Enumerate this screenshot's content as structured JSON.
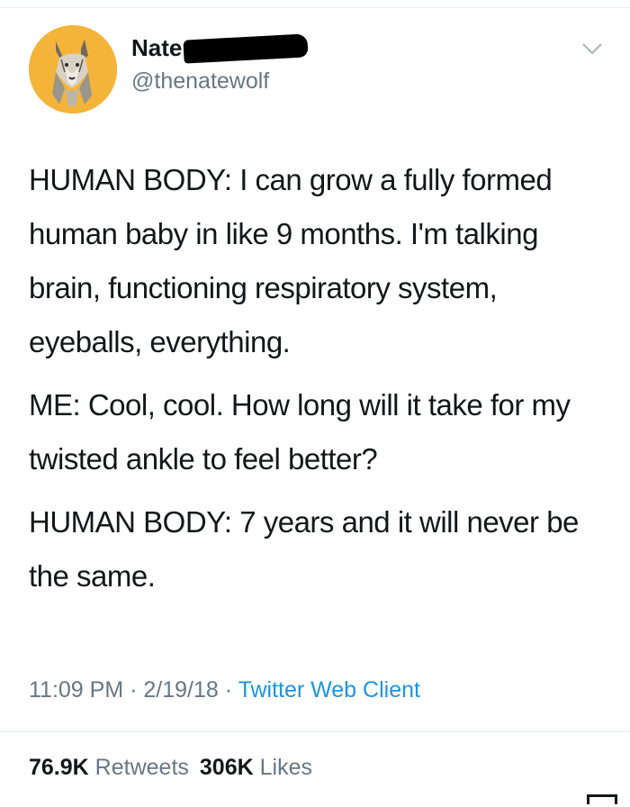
{
  "user": {
    "display_name": "Nate",
    "handle": "@thenatewolf",
    "avatar_icon": "wolf-avatar"
  },
  "tweet": {
    "paragraphs": [
      "HUMAN BODY: I can grow a fully formed human baby in like 9 months. I'm talking brain, functioning respiratory system, eyeballs, everything.",
      "ME: Cool, cool. How long will it take for my twisted ankle to feel better?",
      "HUMAN BODY: 7 years and it will never be the same."
    ]
  },
  "meta": {
    "time": "11:09 PM",
    "date": "2/19/18",
    "separator": " · ",
    "client": "Twitter Web Client"
  },
  "stats": {
    "retweets_count": "76.9K",
    "retweets_label": "Retweets",
    "likes_count": "306K",
    "likes_label": "Likes"
  },
  "colors": {
    "text": "#14171a",
    "secondary": "#657786",
    "link": "#1b95e0",
    "avatar_bg": "#f4b43a"
  }
}
